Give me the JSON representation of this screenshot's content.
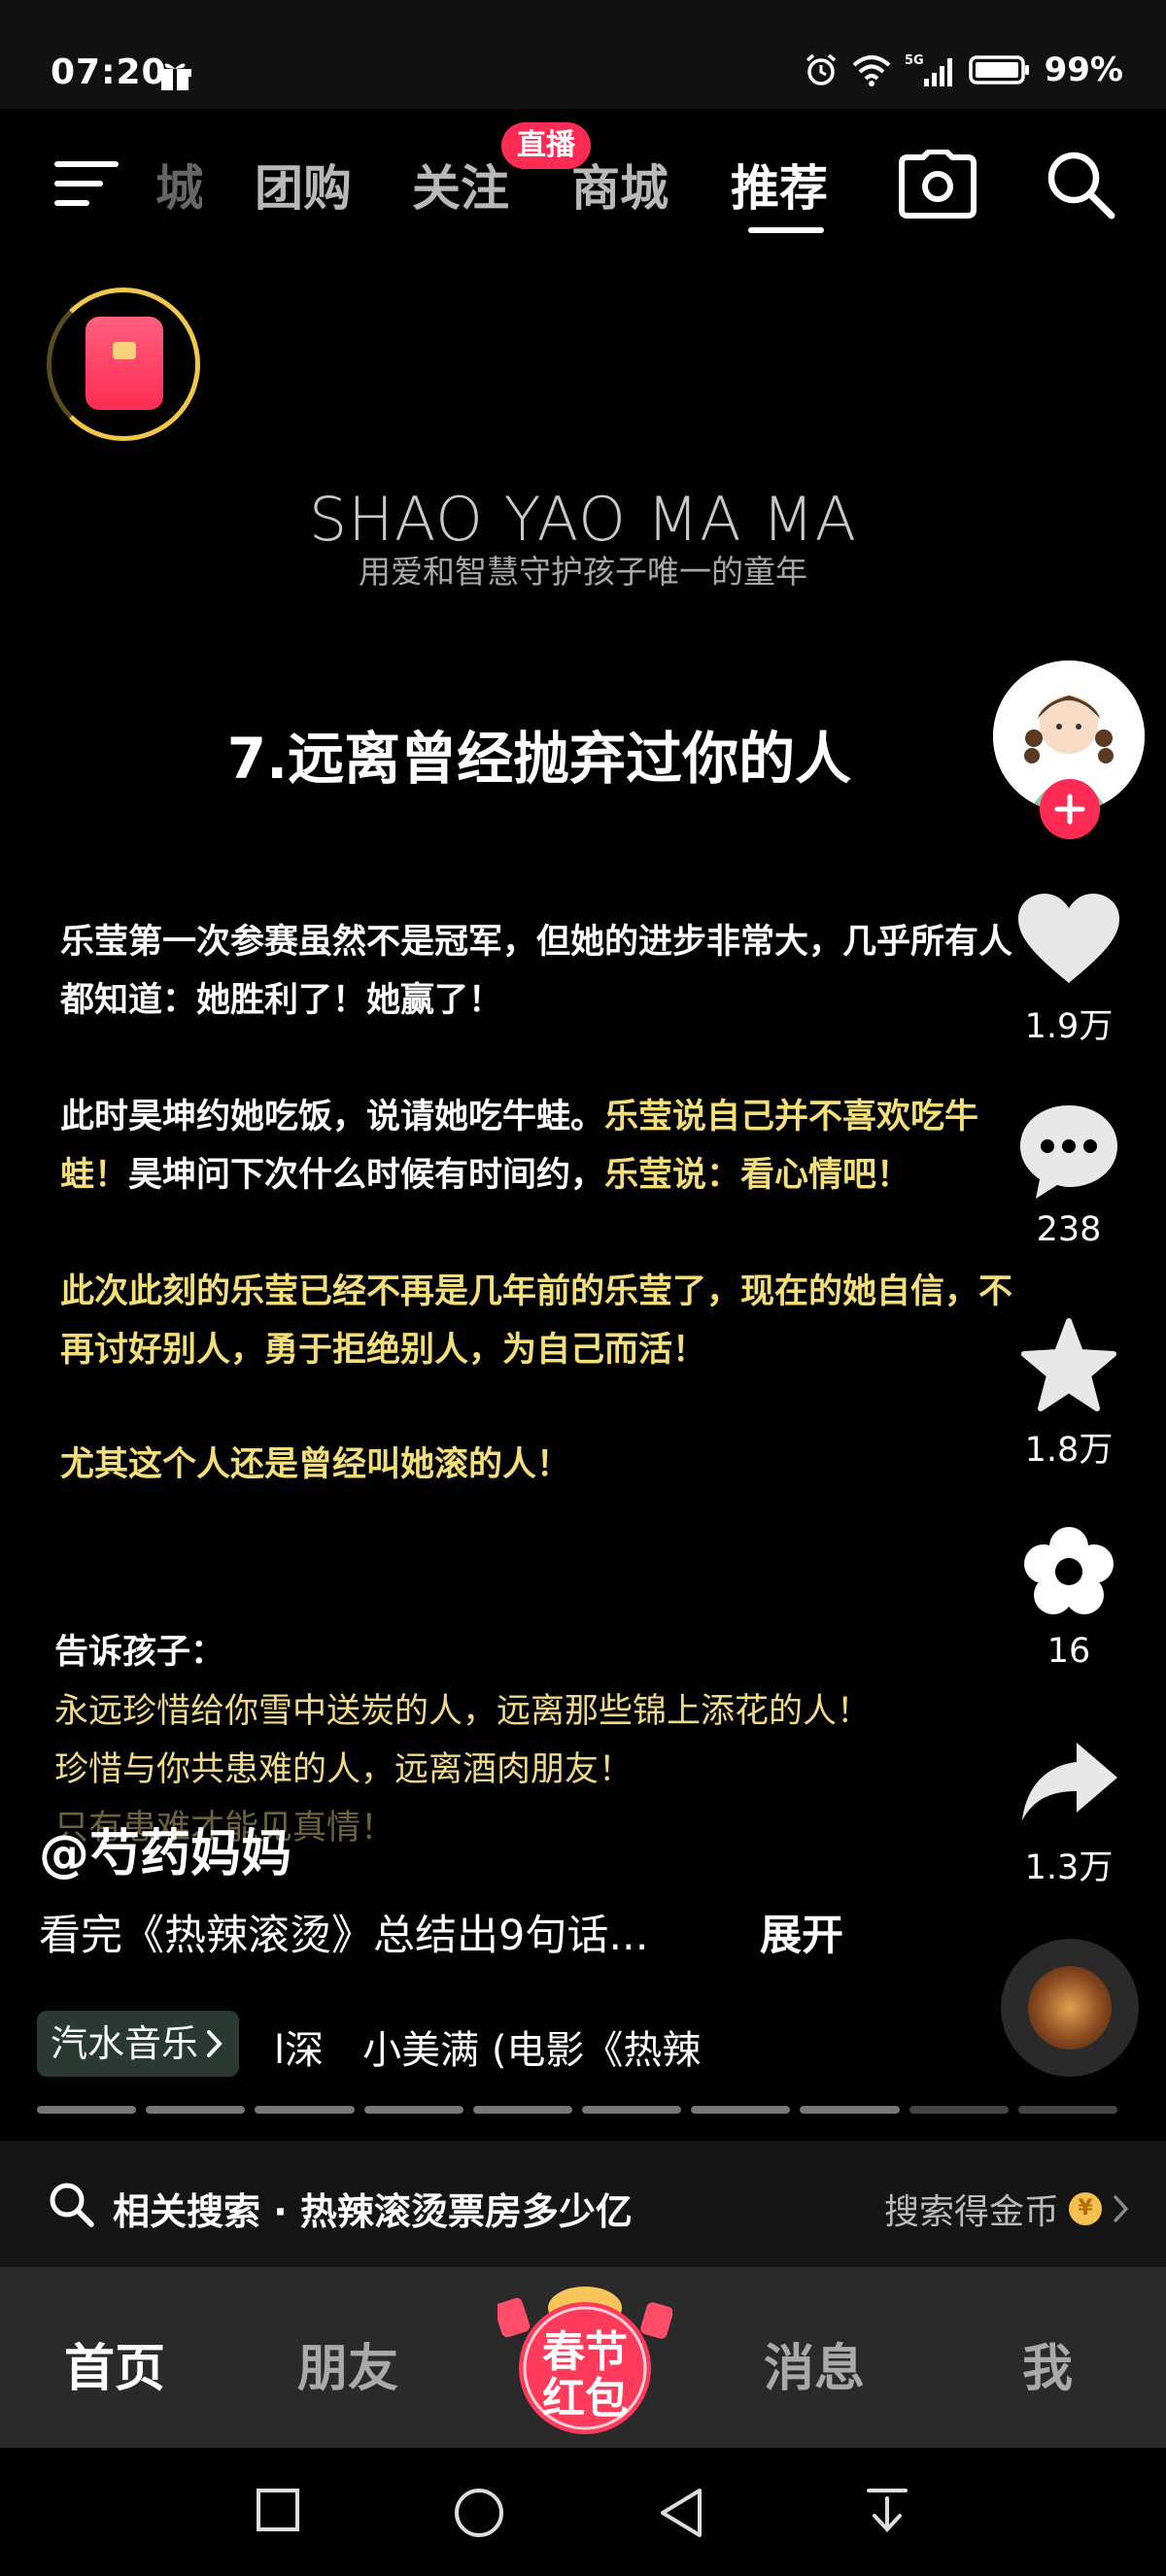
{
  "status_bar": {
    "time": "07:20",
    "battery": "99%",
    "network": "5G"
  },
  "top_nav": {
    "tabs": [
      {
        "label": "城"
      },
      {
        "label": "团购"
      },
      {
        "label": "关注"
      },
      {
        "label": "商城"
      },
      {
        "label": "推荐"
      }
    ],
    "live_badge": "直播",
    "active_tab": "推荐"
  },
  "video": {
    "brand": "SHAO YAO MA MA",
    "brand_sub": "用爱和智慧守护孩子唯一的童年",
    "heading": "7.远离曾经抛弃过你的人",
    "para1": "乐莹第一次参赛虽然不是冠军，但她的进步非常大，几乎所有人都知道：她胜利了！她赢了！",
    "para2_white_a": "此时昊坤约她吃饭，说请她吃牛蛙。",
    "para2_yellow_a": "乐莹说自己并不喜欢吃牛蛙！",
    "para2_white_b": "昊坤问下次什么时候有时间约，",
    "para2_yellow_b": "乐莹说：看心情吧！",
    "para3": "此次此刻的乐莹已经不再是几年前的乐莹了，现在的她自信，不再讨好别人，勇于拒绝别人，为自己而活！",
    "para4": "尤其这个人还是曾经叫她滚的人！",
    "tell_heading": "告诉孩子：",
    "tell_lines": [
      "永远珍惜给你雪中送炭的人，远离那些锦上添花的人！",
      "珍惜与你共患难的人，远离酒肉朋友！",
      "只有患难才能见真情！"
    ]
  },
  "rail": {
    "likes": "1.9万",
    "comments": "238",
    "favorites": "1.8万",
    "flower": "16",
    "shares": "1.3万"
  },
  "caption": {
    "author": "@芍药妈妈",
    "description": "看完《热辣滚烫》总结出9句话...",
    "expand": "展开",
    "music_tag": "汽水音乐",
    "music_text": "l深　小美满 (电影《热辣"
  },
  "related": {
    "label": "相关搜索 · 热辣滚烫票房多少亿",
    "right_text": "搜索得金币",
    "coin_symbol": "¥"
  },
  "bottom_tabs": {
    "home": "首页",
    "friends": "朋友",
    "festival": "春节红包",
    "messages": "消息",
    "me": "我"
  },
  "colors": {
    "accent": "#fe2c55",
    "highlight_text": "#f4de7a",
    "gold_ring": "#f1c64b"
  }
}
